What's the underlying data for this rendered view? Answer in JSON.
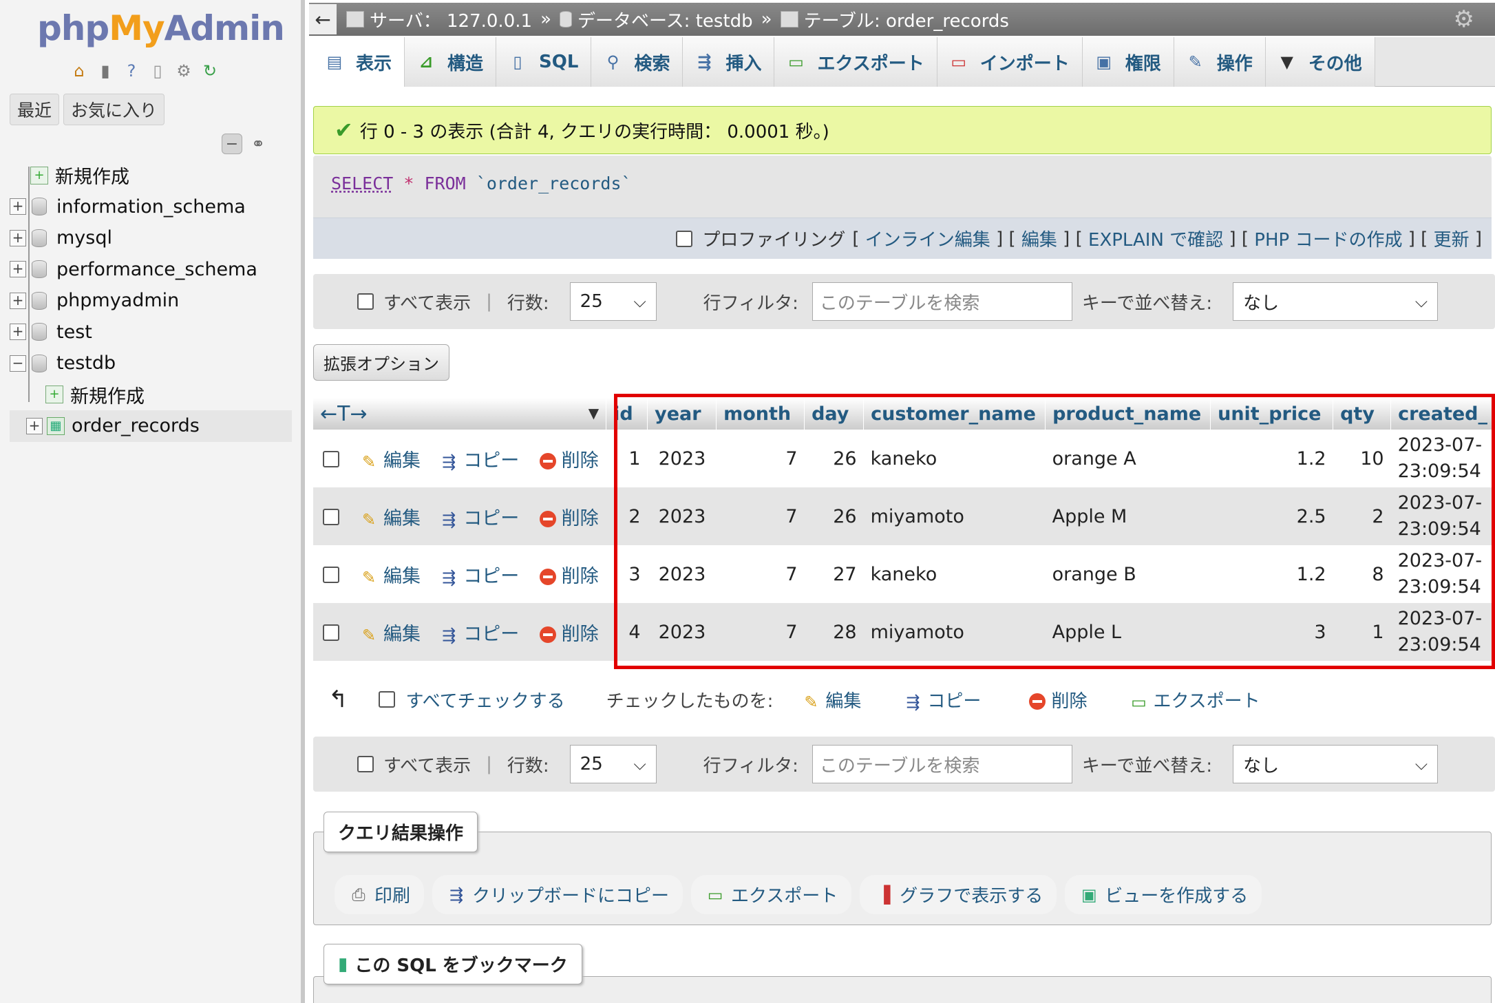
{
  "sidebar": {
    "logo": {
      "php": "php",
      "my": "My",
      "admin": "Admin"
    },
    "tabs": [
      "最近",
      "お気に入り"
    ],
    "tree": [
      {
        "label": "新規作成",
        "type": "new"
      },
      {
        "label": "information_schema",
        "type": "db"
      },
      {
        "label": "mysql",
        "type": "db"
      },
      {
        "label": "performance_schema",
        "type": "db"
      },
      {
        "label": "phpmyadmin",
        "type": "db"
      },
      {
        "label": "test",
        "type": "db"
      },
      {
        "label": "testdb",
        "type": "db-open"
      },
      {
        "label": "新規作成",
        "type": "child-new"
      },
      {
        "label": "order_records",
        "type": "child-table"
      }
    ]
  },
  "breadcrumb": {
    "server": "サーバ： 127.0.0.1",
    "database": "データベース: testdb",
    "table": "テーブル: order_records",
    "separator": "»"
  },
  "tabs": [
    "表示",
    "構造",
    "SQL",
    "検索",
    "挿入",
    "エクスポート",
    "インポート",
    "権限",
    "操作",
    "その他"
  ],
  "success_message": "行 0 - 3 の表示 (合計 4, クエリの実行時間： 0.0001 秒。)",
  "sql": {
    "select": "SELECT",
    "star": "*",
    "from": "FROM",
    "table": "`order_records`"
  },
  "sql_actions": {
    "profiling": "プロファイリング",
    "links": [
      "インライン編集",
      "編集",
      "EXPLAIN で確認",
      "PHP コードの作成",
      "更新"
    ]
  },
  "navbar": {
    "show_all": "すべて表示",
    "rows_label": "行数:",
    "rows_value": "25",
    "filter_label": "行フィルタ:",
    "filter_placeholder": "このテーブルを検索",
    "sort_label": "キーで並べ替え:",
    "sort_value": "なし"
  },
  "extended_options": "拡張オプション",
  "table": {
    "arrows": "←T→",
    "columns": [
      "id",
      "year",
      "month",
      "day",
      "customer_name",
      "product_name",
      "unit_price",
      "qty",
      "created_"
    ],
    "actions": {
      "edit": "編集",
      "copy": "コピー",
      "delete": "削除"
    },
    "rows": [
      {
        "id": "1",
        "year": "2023",
        "month": "7",
        "day": "26",
        "customer_name": "kaneko",
        "product_name": "orange A",
        "unit_price": "1.2",
        "qty": "10",
        "created_date": "2023-07-",
        "created_time": "23:09:54"
      },
      {
        "id": "2",
        "year": "2023",
        "month": "7",
        "day": "26",
        "customer_name": "miyamoto",
        "product_name": "Apple M",
        "unit_price": "2.5",
        "qty": "2",
        "created_date": "2023-07-",
        "created_time": "23:09:54"
      },
      {
        "id": "3",
        "year": "2023",
        "month": "7",
        "day": "27",
        "customer_name": "kaneko",
        "product_name": "orange B",
        "unit_price": "1.2",
        "qty": "8",
        "created_date": "2023-07-",
        "created_time": "23:09:54"
      },
      {
        "id": "4",
        "year": "2023",
        "month": "7",
        "day": "28",
        "customer_name": "miyamoto",
        "product_name": "Apple L",
        "unit_price": "3",
        "qty": "1",
        "created_date": "2023-07-",
        "created_time": "23:09:54"
      }
    ]
  },
  "bulk": {
    "check_all": "すべてチェックする",
    "with_selected": "チェックしたものを:",
    "edit": "編集",
    "copy": "コピー",
    "delete": "削除",
    "export": "エクスポート"
  },
  "query_ops": {
    "legend": "クエリ結果操作",
    "buttons": [
      "印刷",
      "クリップボードにコピー",
      "エクスポート",
      "グラフで表示する",
      "ビューを作成する"
    ]
  },
  "bookmark_legend": "この SQL をブックマーク",
  "colors": {
    "accent": "#235a81",
    "success_bg": "#ebf8a4",
    "highlight_border": "#e10000"
  }
}
